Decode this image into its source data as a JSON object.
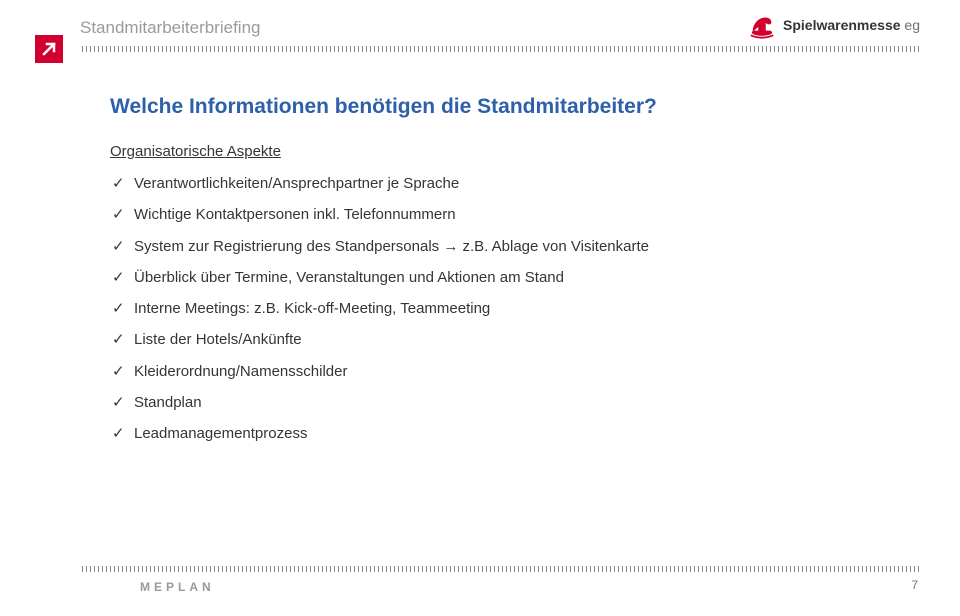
{
  "header": {
    "section_title": "Standmitarbeiterbriefing",
    "brand_main": "Spielwarenmesse",
    "brand_sub": "eg"
  },
  "content": {
    "title": "Welche Informationen benötigen die Standmitarbeiter?",
    "subhead": "Organisatorische Aspekte",
    "items": [
      "Verantwortlichkeiten/Ansprechpartner je Sprache",
      "Wichtige Kontaktpersonen inkl. Telefonnummern",
      "System zur Registrierung des Standpersonals → z.B. Ablage von Visitenkarte",
      "Überblick über Termine, Veranstaltungen und Aktionen am Stand",
      "Interne Meetings: z.B. Kick-off-Meeting, Teammeeting",
      "Liste der Hotels/Ankünfte",
      "Kleiderordnung/Namensschilder",
      "Standplan",
      "Leadmanagementprozess"
    ]
  },
  "footer": {
    "brand": "MEPLAN",
    "page": "7"
  }
}
